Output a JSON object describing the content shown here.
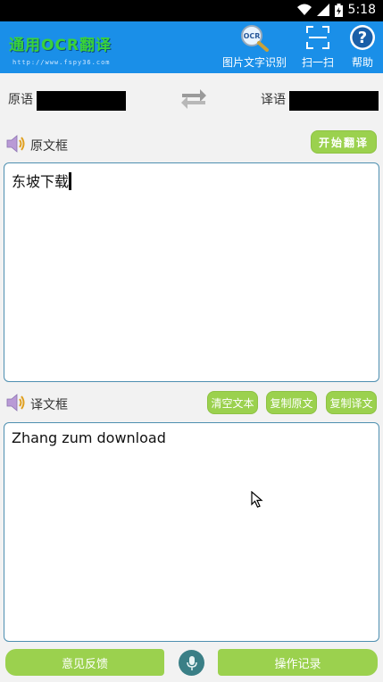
{
  "status_bar": {
    "time": "5:18"
  },
  "app_bar": {
    "title": "通用OCR翻译",
    "subtitle_url": "http://www.fspy36.com",
    "buttons": [
      {
        "label": "图片文字识别",
        "icon": "ocr-magnifier-icon"
      },
      {
        "label": "扫一扫",
        "icon": "scan-frame-icon"
      },
      {
        "label": "帮助",
        "icon": "help-icon"
      }
    ]
  },
  "languages": {
    "source_label": "原语",
    "target_label": "译语",
    "swap_icon": "swap-arrows-icon"
  },
  "source_section": {
    "title": "原文框",
    "start_button": "开始翻译",
    "text": "东坡下载"
  },
  "target_section": {
    "title": "译文框",
    "clear_button": "清空文本",
    "copy_source_button": "复制原文",
    "copy_target_button": "复制译文",
    "text": "Zhang zum download"
  },
  "bottom_bar": {
    "feedback_button": "意见反馈",
    "history_button": "操作记录",
    "mic_icon": "microphone-icon"
  },
  "colors": {
    "app_bar": "#1a8fe8",
    "accent_green": "#9bd14e",
    "textbox_border": "#4e8fb0",
    "mic": "#3a7f86"
  }
}
